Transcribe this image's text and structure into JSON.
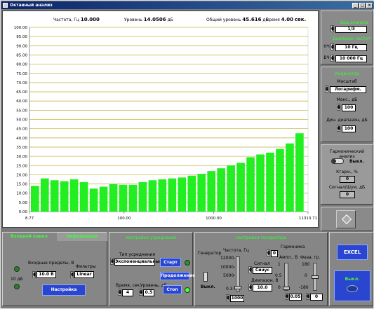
{
  "window": {
    "title": "Октавный анализ",
    "controls": [
      "_",
      "□",
      "×"
    ]
  },
  "readouts": {
    "freq_label": "Частота, Гц",
    "freq_value": "10.000",
    "level_label": "Уровень",
    "level_value": "14.0506",
    "level_unit": "дБ",
    "total_label": "Общий уровень",
    "total_value": "45.616",
    "total_unit": "дБ",
    "time_label": "Время",
    "time_value": "4.00",
    "time_unit": "сек."
  },
  "chart_data": {
    "type": "bar",
    "yticks": [
      "100.00",
      "95.00",
      "90.00",
      "85.00",
      "80.00",
      "75.00",
      "70.00",
      "65.00",
      "60.00",
      "55.00",
      "50.00",
      "45.00",
      "40.00",
      "35.00",
      "30.00",
      "25.00",
      "20.00",
      "15.00",
      "10.00",
      "5.00",
      "0.00"
    ],
    "xticks": [
      "8.77",
      "100.00",
      "1000.00",
      "11313.71"
    ],
    "ylim": [
      0,
      100
    ],
    "xlim": [
      8.77,
      11313.71
    ],
    "x_scale": "log",
    "grid": true,
    "bar_color": "#22ee22",
    "values": [
      14.0,
      18.0,
      17.0,
      16.5,
      17.5,
      16.0,
      12.5,
      13.5,
      15.0,
      14.5,
      14.5,
      16.0,
      17.0,
      17.5,
      18.0,
      18.5,
      19.5,
      20.5,
      22.0,
      23.5,
      25.0,
      26.5,
      29.5,
      31.0,
      32.0,
      34.0,
      37.0,
      42.5
    ]
  },
  "right_top": {
    "view_label": "Вид анализа",
    "view_value": "1/3",
    "range_label": "Диапазон частот",
    "low_label": "НЧ",
    "low_value": "10 Гц",
    "high_label": "ВЧ",
    "high_value": "10 000 Гц"
  },
  "right_mid": {
    "section_label": "Индикатор",
    "scale_label": "Масштаб",
    "scale_value": "Логарифм.",
    "max_label": "Макс., дБ",
    "max_value": "100",
    "dyn_label": "Дин. диапазон, дБ",
    "dyn_value": "100"
  },
  "right_harm": {
    "label": "Гармонический анализ",
    "toggle_label": "Выкл.",
    "kharm_label": "Кгарм., %",
    "kharm_value": "0",
    "snr_label": "Сигнал/Шум, дБ",
    "snr_value": "0"
  },
  "input_channel": {
    "tab_input": "Входной канал",
    "tab_info": "Информация",
    "limits_label": "Входные пределы, В",
    "limits_value": "10.0 В",
    "filters_label": "Фильтры",
    "filters_value": "Linear",
    "db_label": "10 дБ",
    "setup_button": "Настройка"
  },
  "averaging": {
    "title": "Настройки усреднения",
    "type_label": "Тип усреднения",
    "type_value": "Экспоненциальный",
    "time_label": "Время, сек.",
    "time_value": "4",
    "level_label": "Уровень, дБ",
    "level_value": "0.5",
    "start_button": "Старт",
    "continue_button": "Продолжение",
    "stop_button": "Стоп"
  },
  "generator": {
    "title": "Настройки генератора",
    "gen_label": "Генератор",
    "gen_toggle": "Выкл.",
    "freq_label": "Частота, Гц",
    "freq_ticks": [
      "12000-",
      "10000-",
      "5000-",
      "0.3-"
    ],
    "freq_value": "1000",
    "harm_label": "Гармоника",
    "harm_value": "0",
    "signal_label": "Сигнал",
    "signal_value": "Синус",
    "range_label": "Диапазон, В",
    "range_value": "10.0",
    "amp_label": "Ампл., В",
    "amp_ticks": [
      "1",
      "0.5",
      "0"
    ],
    "amp_value": "0.05",
    "phase_label": "Фаза, гр.",
    "phase_ticks": [
      "180",
      "0",
      "-180"
    ],
    "phase_value": "0"
  },
  "actions": {
    "excel_button": "EXCEL",
    "off_label": "Выкл."
  }
}
